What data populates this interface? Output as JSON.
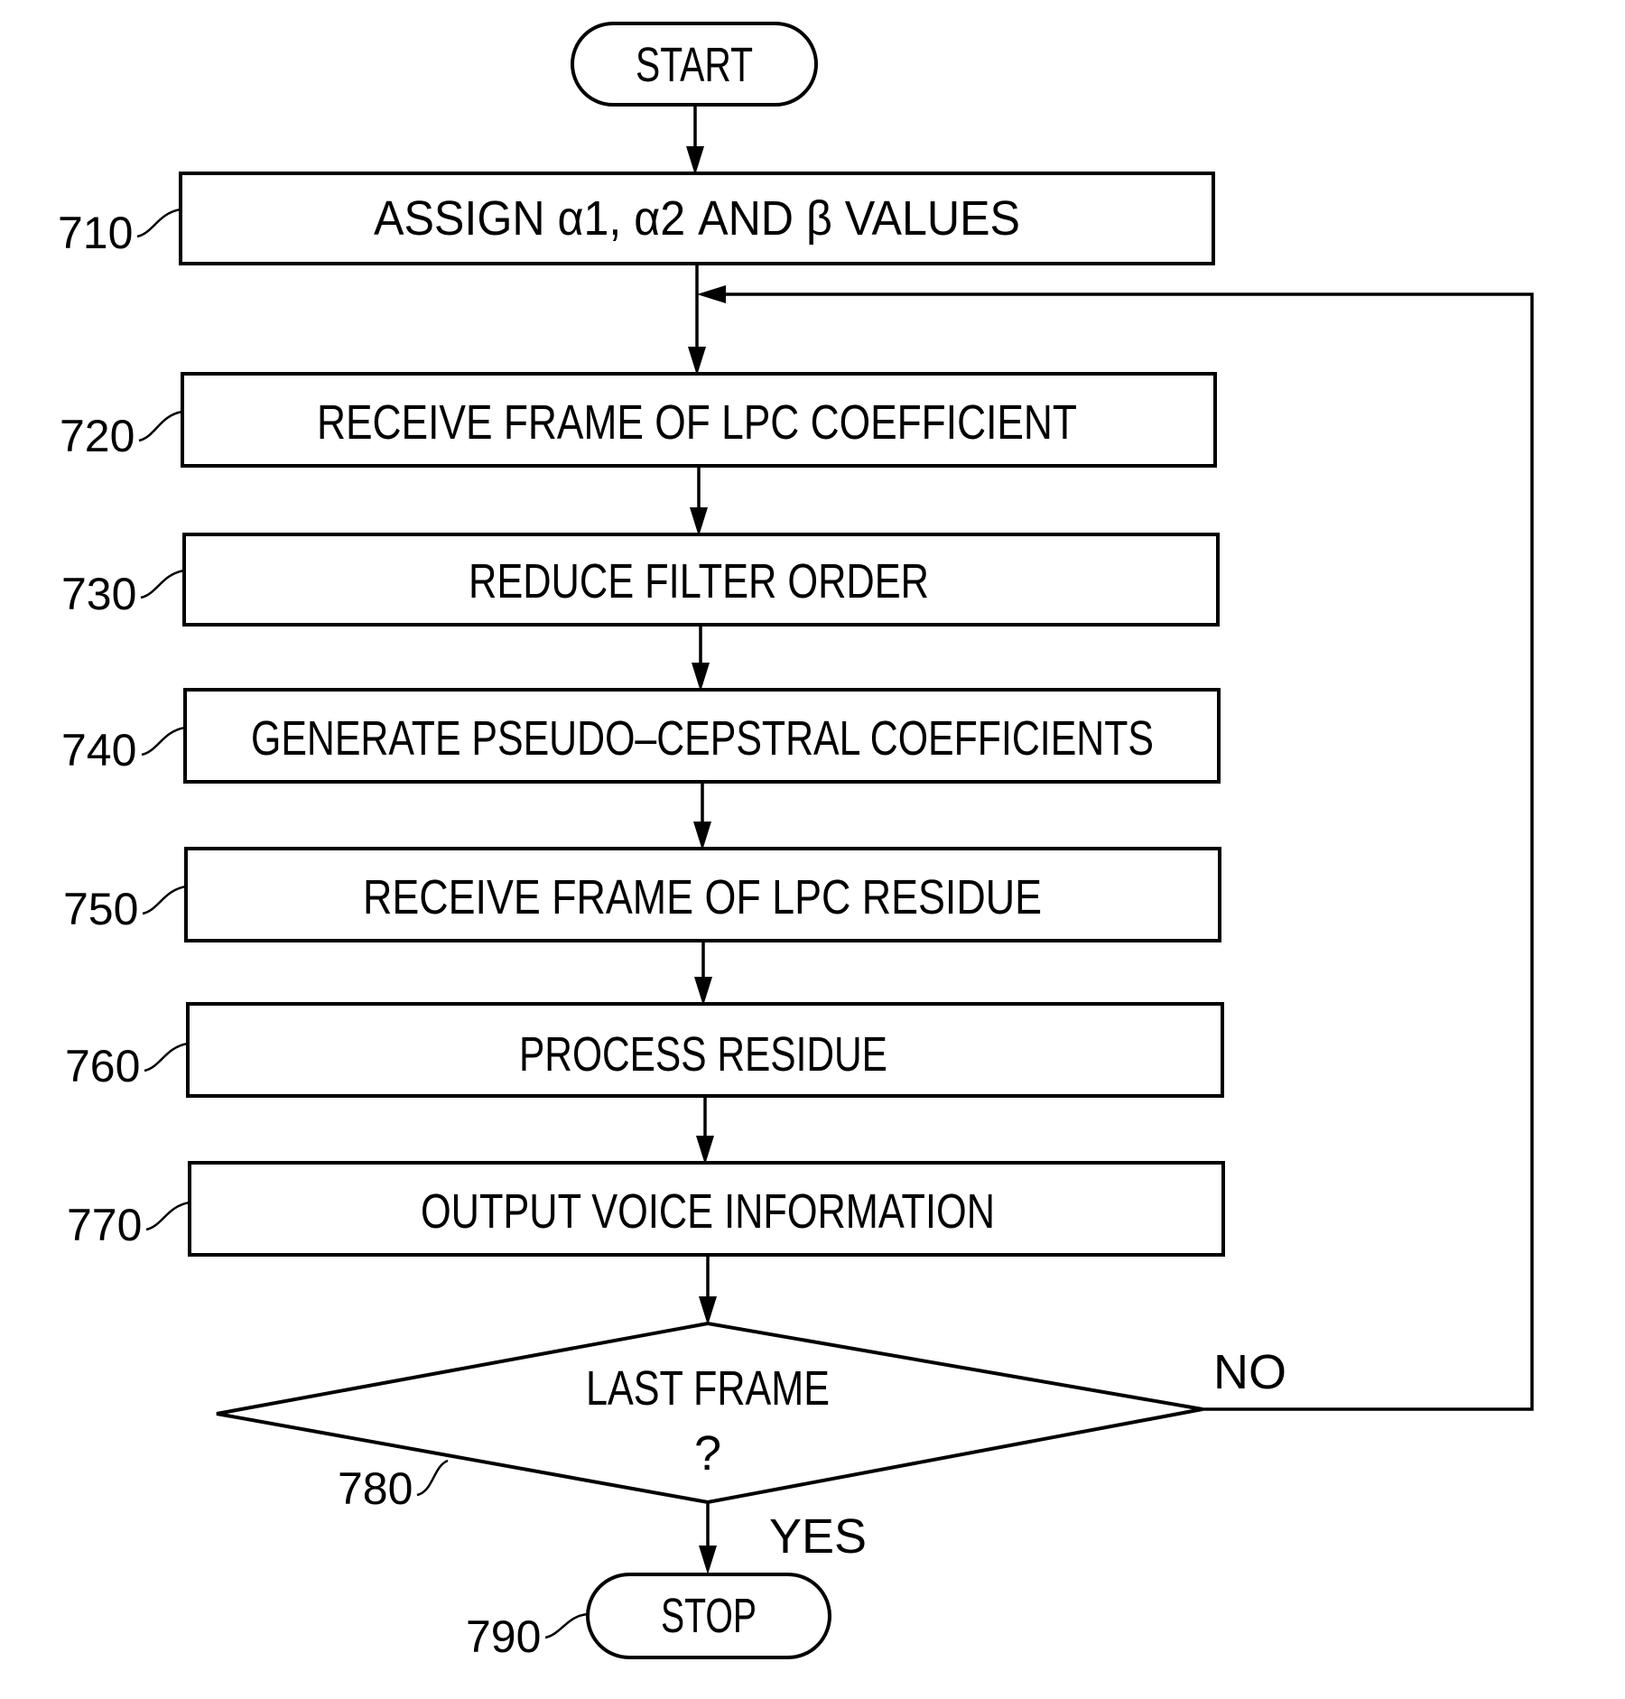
{
  "diagram": {
    "type": "flowchart",
    "start": {
      "label": "START"
    },
    "steps": [
      {
        "ref": "710",
        "label": "ASSIGN α1, α2 AND β VALUES"
      },
      {
        "ref": "720",
        "label": "RECEIVE FRAME OF LPC COEFFICIENT"
      },
      {
        "ref": "730",
        "label": "REDUCE FILTER ORDER"
      },
      {
        "ref": "740",
        "label": "GENERATE PSEUDO–CEPSTRAL COEFFICIENTS"
      },
      {
        "ref": "750",
        "label": "RECEIVE FRAME OF LPC RESIDUE"
      },
      {
        "ref": "760",
        "label": "PROCESS RESIDUE"
      },
      {
        "ref": "770",
        "label": "OUTPUT VOICE INFORMATION"
      }
    ],
    "decision": {
      "ref": "780",
      "line1": "LAST FRAME",
      "line2": "?",
      "no_label": "NO",
      "yes_label": "YES"
    },
    "stop": {
      "ref": "790",
      "label": "STOP"
    }
  }
}
